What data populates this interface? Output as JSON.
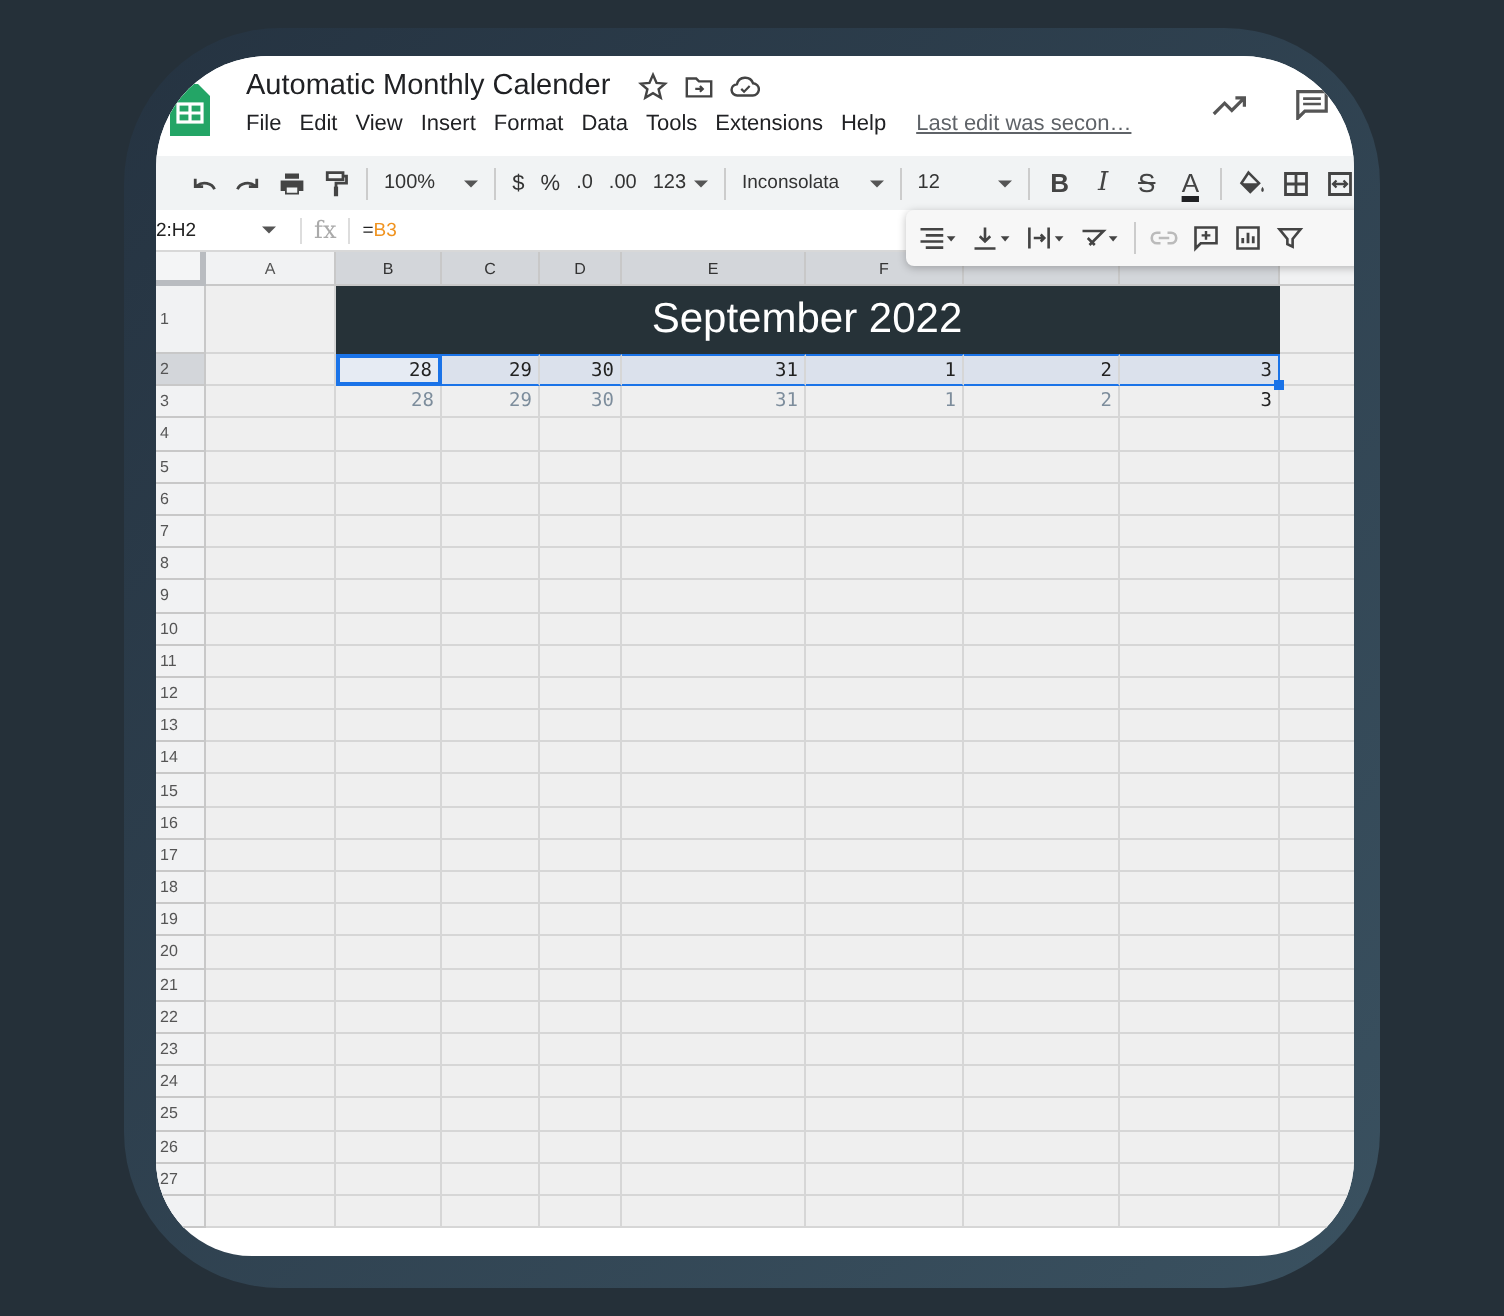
{
  "document": {
    "title": "Automatic Monthly Calender",
    "menu": [
      "File",
      "Edit",
      "View",
      "Insert",
      "Format",
      "Data",
      "Tools",
      "Extensions",
      "Help"
    ],
    "last_edit": "Last edit was secon…"
  },
  "toolbar": {
    "zoom": "100%",
    "currency": "$",
    "percent": "%",
    "decrease_decimals": ".0",
    "increase_decimals": ".00",
    "number_format": "123",
    "font": "Inconsolata",
    "font_size": "12",
    "text_styles": [
      "B",
      "I",
      "S",
      "A"
    ]
  },
  "formula_bar": {
    "range": "2:H2",
    "function_label": "fx",
    "operator": "=",
    "reference": "B3"
  },
  "floating_toolbar": {
    "insert_link": {
      "disabled": true
    }
  },
  "sheet": {
    "column_headers": [
      "A",
      "B",
      "C",
      "D",
      "E",
      "F"
    ],
    "row_numbers": [
      "1",
      "2",
      "3",
      "4",
      "5",
      "6",
      "7",
      "8",
      "9",
      "10",
      "11",
      "12",
      "13",
      "14",
      "15",
      "16",
      "17",
      "18",
      "19",
      "20",
      "21",
      "22",
      "23",
      "24",
      "25",
      "26",
      "27"
    ],
    "title": "September 2022",
    "rows": [
      {
        "selected": true,
        "cells": [
          {
            "value": "28",
            "active": true,
            "dimmed": false
          },
          {
            "value": "29",
            "active": false,
            "dimmed": false
          },
          {
            "value": "30",
            "active": false,
            "dimmed": false
          },
          {
            "value": "31",
            "active": false,
            "dimmed": false
          },
          {
            "value": "1",
            "active": false,
            "dimmed": false
          },
          {
            "value": "2",
            "active": false,
            "dimmed": false
          },
          {
            "value": "3",
            "active": false,
            "dimmed": false
          }
        ]
      },
      {
        "selected": false,
        "cells": [
          {
            "value": "28",
            "active": false,
            "dimmed": true
          },
          {
            "value": "29",
            "active": false,
            "dimmed": true
          },
          {
            "value": "30",
            "active": false,
            "dimmed": true
          },
          {
            "value": "31",
            "active": false,
            "dimmed": true
          },
          {
            "value": "1",
            "active": false,
            "dimmed": true
          },
          {
            "value": "2",
            "active": false,
            "dimmed": true
          },
          {
            "value": "3",
            "active": false,
            "dimmed": false
          }
        ]
      }
    ]
  }
}
